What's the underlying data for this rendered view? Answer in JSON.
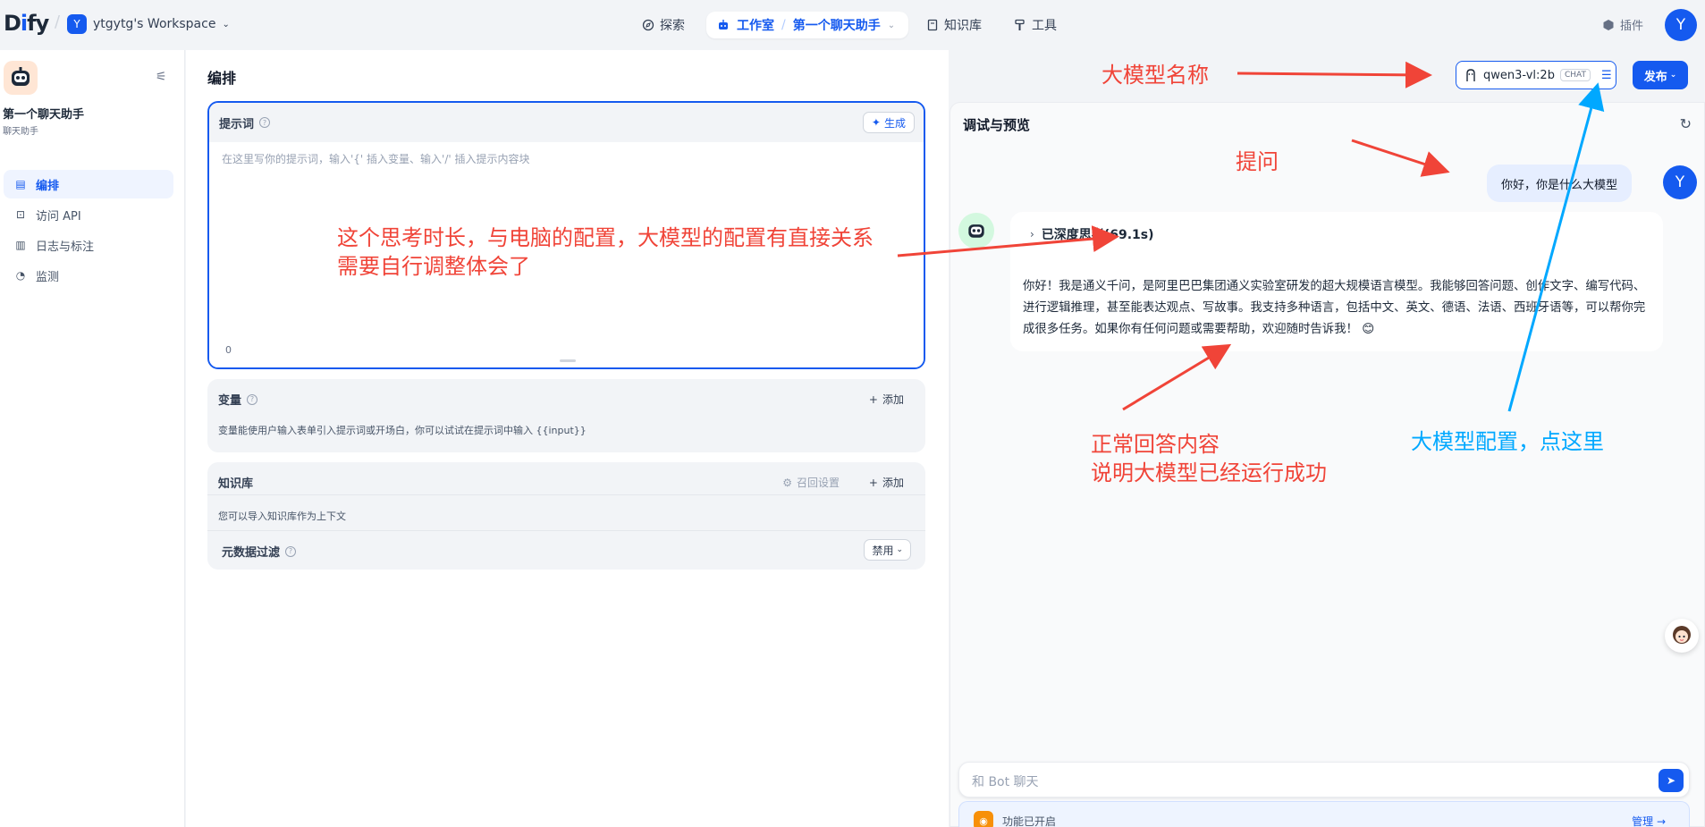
{
  "topbar": {
    "logo": "Dify",
    "workspace_initial": "Y",
    "workspace_name": "ytgytg's Workspace",
    "nav": {
      "explore": "探索",
      "studio": "工作室",
      "current_app": "第一个聊天助手",
      "knowledge": "知识库",
      "tools": "工具"
    },
    "plugins": "插件",
    "user_initial": "Y"
  },
  "sidebar": {
    "app_name": "第一个聊天助手",
    "app_type": "聊天助手",
    "items": [
      {
        "label": "编排",
        "icon": "layout-icon",
        "active": true
      },
      {
        "label": "访问 API",
        "icon": "terminal-icon",
        "active": false
      },
      {
        "label": "日志与标注",
        "icon": "document-icon",
        "active": false
      },
      {
        "label": "监测",
        "icon": "gauge-icon",
        "active": false
      }
    ]
  },
  "editor": {
    "title": "编排",
    "prompt": {
      "label": "提示词",
      "generate_label": "生成",
      "placeholder": "在这里写你的提示词，输入'{' 插入变量、输入'/' 插入提示内容块",
      "char_count": "0"
    },
    "variables": {
      "label": "变量",
      "add_label": "添加",
      "description": "变量能使用户输入表单引入提示词或开场白，你可以试试在提示词中输入 {{input}}"
    },
    "knowledge": {
      "label": "知识库",
      "recall_label": "召回设置",
      "add_label": "添加",
      "description": "您可以导入知识库作为上下文"
    },
    "metadata_filter": {
      "label": "元数据过滤",
      "value": "禁用"
    }
  },
  "header_actions": {
    "model_name": "qwen3-vl:2b",
    "model_badge": "CHAT",
    "publish_label": "发布"
  },
  "debug": {
    "title": "调试与预览",
    "user_initial": "Y",
    "user_message": "你好，你是什么大模型",
    "thinking_label": "已深度思考(69.1s)",
    "answer": "你好！我是通义千问，是阿里巴巴集团通义实验室研发的超大规模语言模型。我能够回答问题、创作文字、编写代码、进行逻辑推理，甚至能表达观点、写故事。我支持多种语言，包括中文、英文、德语、法语、西班牙语等，可以帮你完成很多任务。如果你有任何问题或需要帮助，欢迎随时告诉我！ 😊",
    "input_placeholder": "和 Bot 聊天",
    "features_enabled": "功能已开启",
    "manage_label": "管理 →"
  },
  "annotations": {
    "model_name_note": "大模型名称",
    "question_note": "提问",
    "thinking_note_line1": "这个思考时长，与电脑的配置，大模型的配置有直接关系",
    "thinking_note_line2": "需要自行调整体会了",
    "answer_note_line1": "正常回答内容",
    "answer_note_line2": "说明大模型已经运行成功",
    "config_note": "大模型配置，点这里"
  },
  "colors": {
    "accent": "#155aef",
    "annotation_red": "#f04438",
    "annotation_blue": "#00a8ff"
  }
}
